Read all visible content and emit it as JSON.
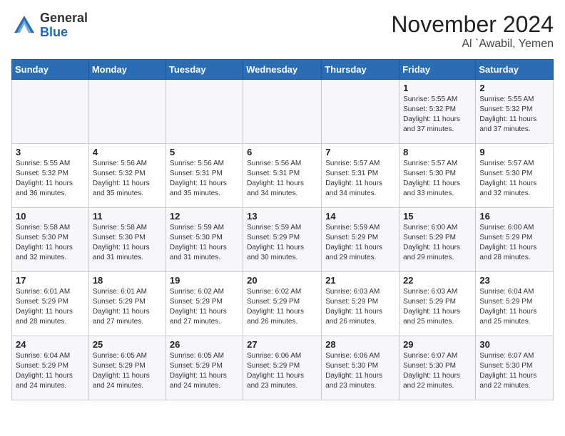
{
  "header": {
    "logo_line1": "General",
    "logo_line2": "Blue",
    "month_year": "November 2024",
    "location": "Al `Awabil, Yemen"
  },
  "weekdays": [
    "Sunday",
    "Monday",
    "Tuesday",
    "Wednesday",
    "Thursday",
    "Friday",
    "Saturday"
  ],
  "weeks": [
    [
      {
        "day": "",
        "info": ""
      },
      {
        "day": "",
        "info": ""
      },
      {
        "day": "",
        "info": ""
      },
      {
        "day": "",
        "info": ""
      },
      {
        "day": "",
        "info": ""
      },
      {
        "day": "1",
        "info": "Sunrise: 5:55 AM\nSunset: 5:32 PM\nDaylight: 11 hours and 37 minutes."
      },
      {
        "day": "2",
        "info": "Sunrise: 5:55 AM\nSunset: 5:32 PM\nDaylight: 11 hours and 37 minutes."
      }
    ],
    [
      {
        "day": "3",
        "info": "Sunrise: 5:55 AM\nSunset: 5:32 PM\nDaylight: 11 hours and 36 minutes."
      },
      {
        "day": "4",
        "info": "Sunrise: 5:56 AM\nSunset: 5:32 PM\nDaylight: 11 hours and 35 minutes."
      },
      {
        "day": "5",
        "info": "Sunrise: 5:56 AM\nSunset: 5:31 PM\nDaylight: 11 hours and 35 minutes."
      },
      {
        "day": "6",
        "info": "Sunrise: 5:56 AM\nSunset: 5:31 PM\nDaylight: 11 hours and 34 minutes."
      },
      {
        "day": "7",
        "info": "Sunrise: 5:57 AM\nSunset: 5:31 PM\nDaylight: 11 hours and 34 minutes."
      },
      {
        "day": "8",
        "info": "Sunrise: 5:57 AM\nSunset: 5:30 PM\nDaylight: 11 hours and 33 minutes."
      },
      {
        "day": "9",
        "info": "Sunrise: 5:57 AM\nSunset: 5:30 PM\nDaylight: 11 hours and 32 minutes."
      }
    ],
    [
      {
        "day": "10",
        "info": "Sunrise: 5:58 AM\nSunset: 5:30 PM\nDaylight: 11 hours and 32 minutes."
      },
      {
        "day": "11",
        "info": "Sunrise: 5:58 AM\nSunset: 5:30 PM\nDaylight: 11 hours and 31 minutes."
      },
      {
        "day": "12",
        "info": "Sunrise: 5:59 AM\nSunset: 5:30 PM\nDaylight: 11 hours and 31 minutes."
      },
      {
        "day": "13",
        "info": "Sunrise: 5:59 AM\nSunset: 5:29 PM\nDaylight: 11 hours and 30 minutes."
      },
      {
        "day": "14",
        "info": "Sunrise: 5:59 AM\nSunset: 5:29 PM\nDaylight: 11 hours and 29 minutes."
      },
      {
        "day": "15",
        "info": "Sunrise: 6:00 AM\nSunset: 5:29 PM\nDaylight: 11 hours and 29 minutes."
      },
      {
        "day": "16",
        "info": "Sunrise: 6:00 AM\nSunset: 5:29 PM\nDaylight: 11 hours and 28 minutes."
      }
    ],
    [
      {
        "day": "17",
        "info": "Sunrise: 6:01 AM\nSunset: 5:29 PM\nDaylight: 11 hours and 28 minutes."
      },
      {
        "day": "18",
        "info": "Sunrise: 6:01 AM\nSunset: 5:29 PM\nDaylight: 11 hours and 27 minutes."
      },
      {
        "day": "19",
        "info": "Sunrise: 6:02 AM\nSunset: 5:29 PM\nDaylight: 11 hours and 27 minutes."
      },
      {
        "day": "20",
        "info": "Sunrise: 6:02 AM\nSunset: 5:29 PM\nDaylight: 11 hours and 26 minutes."
      },
      {
        "day": "21",
        "info": "Sunrise: 6:03 AM\nSunset: 5:29 PM\nDaylight: 11 hours and 26 minutes."
      },
      {
        "day": "22",
        "info": "Sunrise: 6:03 AM\nSunset: 5:29 PM\nDaylight: 11 hours and 25 minutes."
      },
      {
        "day": "23",
        "info": "Sunrise: 6:04 AM\nSunset: 5:29 PM\nDaylight: 11 hours and 25 minutes."
      }
    ],
    [
      {
        "day": "24",
        "info": "Sunrise: 6:04 AM\nSunset: 5:29 PM\nDaylight: 11 hours and 24 minutes."
      },
      {
        "day": "25",
        "info": "Sunrise: 6:05 AM\nSunset: 5:29 PM\nDaylight: 11 hours and 24 minutes."
      },
      {
        "day": "26",
        "info": "Sunrise: 6:05 AM\nSunset: 5:29 PM\nDaylight: 11 hours and 24 minutes."
      },
      {
        "day": "27",
        "info": "Sunrise: 6:06 AM\nSunset: 5:29 PM\nDaylight: 11 hours and 23 minutes."
      },
      {
        "day": "28",
        "info": "Sunrise: 6:06 AM\nSunset: 5:30 PM\nDaylight: 11 hours and 23 minutes."
      },
      {
        "day": "29",
        "info": "Sunrise: 6:07 AM\nSunset: 5:30 PM\nDaylight: 11 hours and 22 minutes."
      },
      {
        "day": "30",
        "info": "Sunrise: 6:07 AM\nSunset: 5:30 PM\nDaylight: 11 hours and 22 minutes."
      }
    ]
  ]
}
